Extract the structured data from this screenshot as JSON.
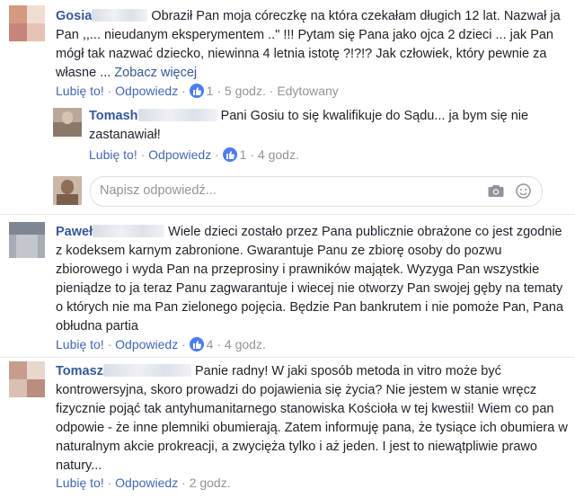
{
  "comments": [
    {
      "author": "Gosia",
      "text": "Obraził Pan moja córeczkę na która czekałam długich 12 lat. Nazwał ja Pan ,,... nieudanym eksperymentem ..\" !!! Pytam się Pana jako ojca 2 dzieci ... jak Pan mógł tak nazwać dziecko, niewinna 4 letnia istotę ?!?!? Jak człowiek, który pewnie za własne ...",
      "see_more": "Zobacz więcej",
      "like": "Lubię to!",
      "reply": "Odpowiedz",
      "reactions": "1",
      "time": "5 godz.",
      "edited": "Edytowany"
    },
    {
      "author": "Tomash",
      "text": "Pani Gosiu to się kwalifikuje do Sądu... ja bym się nie zastanawiał!",
      "like": "Lubię to!",
      "reply": "Odpowiedz",
      "reactions": "1",
      "time": "4 godz."
    },
    {
      "author": "Paweł",
      "text": "Wiele dzieci zostało przez Pana publicznie obrażone co jest zgodnie z kodeksem karnym zabronione. Gwarantuje Panu ze zbiorę osoby do pozwu zbiorowego i wyda Pan na przeprosiny i prawników majątek. Wyzyga Pan wszystkie pieniądze to ja teraz Panu zagwarantuje i wiecej nie otworzy Pan swojej gęby na tematy o których nie ma Pan zielonego pojęcia. Będzie Pan bankrutem i nie pomoże Pan, Pana obłudna partia",
      "like": "Lubię to!",
      "reply": "Odpowiedz",
      "reactions": "4",
      "time": "4 godz."
    },
    {
      "author": "Tomasz",
      "text": "Panie radny! W jaki sposób metoda in vitro może być kontrowersyjna, skoro prowadzi do pojawienia się życia? Nie jestem w stanie wręcz fizycznie pojąć tak antyhumanitarnego stanowiska Kościoła w tej kwestii! Wiem co pan odpowie - że inne plemniki obumierają. Zatem informuję pana, że tysiące ich obumiera w naturalnym akcie prokreacji, a zwycięża tylko i aż jeden. I jest to niewątpliwie prawo natury...",
      "like": "Lubię to!",
      "reply": "Odpowiedz",
      "time": "2 godz."
    }
  ],
  "reply_box": {
    "placeholder": "Napisz odpowiedź..."
  },
  "icons": [
    "like-icon",
    "camera-icon",
    "emoji-icon"
  ]
}
